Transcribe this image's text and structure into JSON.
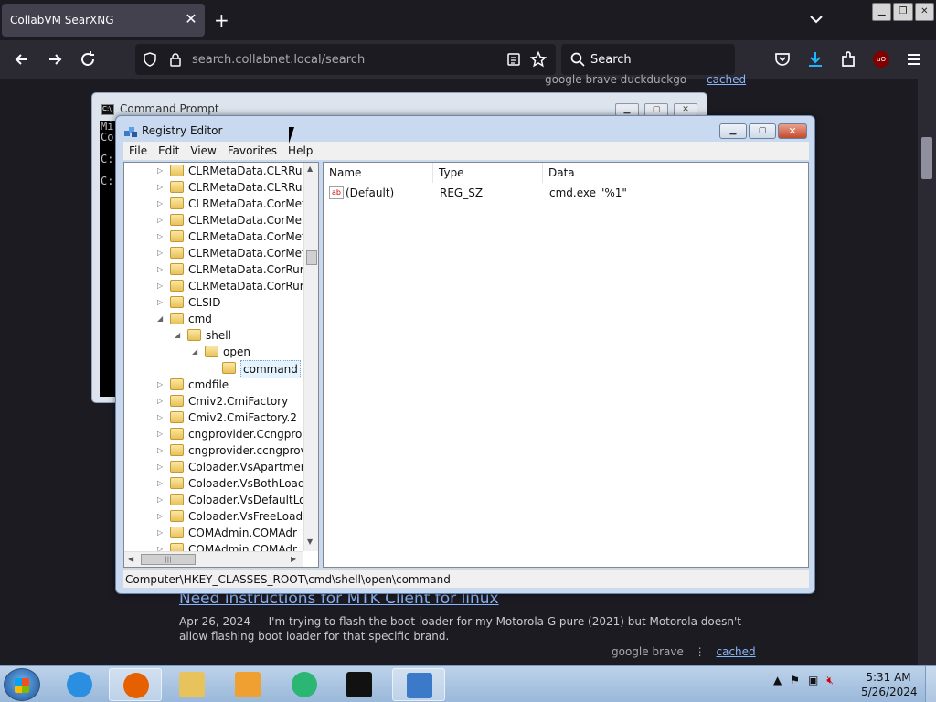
{
  "browser": {
    "tab_title": "CollabVM SearXNG",
    "tab_close": "✕",
    "new_tab": "+",
    "url_host": "search.collabnet.local",
    "url_path": "/search",
    "search_placeholder": "Search",
    "accent_color": "#0060df"
  },
  "page": {
    "top_meta": {
      "engines": "google  brave  duckduckgo",
      "cached": "cached"
    },
    "result": {
      "title": "Need instructions for MTK Client for linux",
      "snippet": "Apr 26, 2024 — I'm trying to flash the boot loader for my Motorola G pure (2021) but Motorola doesn't allow flashing boot loader for that specific brand.",
      "engines": "google  brave",
      "separator": "⋮",
      "cached": "cached"
    }
  },
  "cmd_window": {
    "title": "Command Prompt",
    "lines": [
      "Mi",
      "Co",
      "",
      "C:",
      "",
      "C:"
    ]
  },
  "regedit": {
    "title": "Registry Editor",
    "menu": [
      "File",
      "Edit",
      "View",
      "Favorites",
      "Help"
    ],
    "tree": [
      {
        "label": "CLRMetaData.CLRRur",
        "level": 0,
        "expander": "▷"
      },
      {
        "label": "CLRMetaData.CLRRur",
        "level": 0,
        "expander": "▷"
      },
      {
        "label": "CLRMetaData.CorMet",
        "level": 0,
        "expander": "▷"
      },
      {
        "label": "CLRMetaData.CorMet",
        "level": 0,
        "expander": "▷"
      },
      {
        "label": "CLRMetaData.CorMet",
        "level": 0,
        "expander": "▷"
      },
      {
        "label": "CLRMetaData.CorMet",
        "level": 0,
        "expander": "▷"
      },
      {
        "label": "CLRMetaData.CorRur",
        "level": 0,
        "expander": "▷"
      },
      {
        "label": "CLRMetaData.CorRur",
        "level": 0,
        "expander": "▷"
      },
      {
        "label": "CLSID",
        "level": 0,
        "expander": "▷"
      },
      {
        "label": "cmd",
        "level": 0,
        "expander": "◢"
      },
      {
        "label": "shell",
        "level": 1,
        "expander": "◢"
      },
      {
        "label": "open",
        "level": 2,
        "expander": "◢"
      },
      {
        "label": "command",
        "level": 3,
        "expander": "",
        "selected": true
      },
      {
        "label": "cmdfile",
        "level": 0,
        "expander": "▷"
      },
      {
        "label": "Cmiv2.CmiFactory",
        "level": 0,
        "expander": "▷"
      },
      {
        "label": "Cmiv2.CmiFactory.2",
        "level": 0,
        "expander": "▷"
      },
      {
        "label": "cngprovider.Ccngpro",
        "level": 0,
        "expander": "▷"
      },
      {
        "label": "cngprovider.ccngprov",
        "level": 0,
        "expander": "▷"
      },
      {
        "label": "Coloader.VsApartmer",
        "level": 0,
        "expander": "▷"
      },
      {
        "label": "Coloader.VsBothLoad",
        "level": 0,
        "expander": "▷"
      },
      {
        "label": "Coloader.VsDefaultLo",
        "level": 0,
        "expander": "▷"
      },
      {
        "label": "Coloader.VsFreeLoade",
        "level": 0,
        "expander": "▷"
      },
      {
        "label": "COMAdmin.COMAdr",
        "level": 0,
        "expander": "▷"
      },
      {
        "label": "COMAdmin.COMAdr",
        "level": 0,
        "expander": "▷"
      }
    ],
    "columns": [
      "Name",
      "Type",
      "Data"
    ],
    "values": [
      {
        "name": "(Default)",
        "type": "REG_SZ",
        "data": "cmd.exe \"%1\""
      }
    ],
    "value_icon": "ab",
    "status_path": "Computer\\HKEY_CLASSES_ROOT\\cmd\\shell\\open\\command"
  },
  "taskbar": {
    "apps": [
      {
        "name": "internet-explorer",
        "color": "#2a8fe0"
      },
      {
        "name": "firefox",
        "color": "#e66000"
      },
      {
        "name": "file-explorer",
        "color": "#e8c25a"
      },
      {
        "name": "media-player",
        "color": "#f0a030"
      },
      {
        "name": "collab-app",
        "color": "#2bb673"
      },
      {
        "name": "command-prompt",
        "color": "#111111"
      },
      {
        "name": "registry-editor",
        "color": "#3a7ac8"
      }
    ],
    "time": "5:31 AM",
    "date": "5/26/2024"
  }
}
